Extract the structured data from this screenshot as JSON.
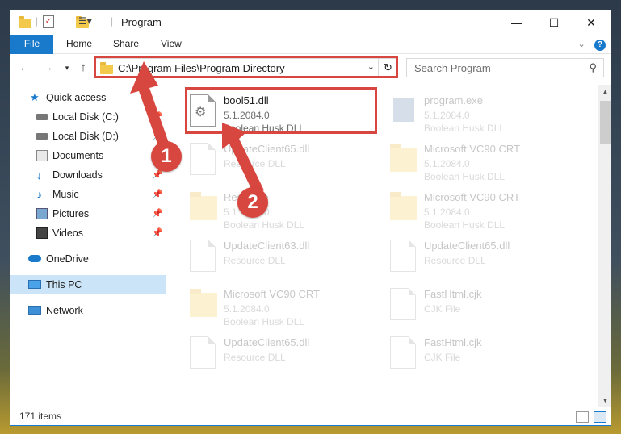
{
  "window": {
    "title": "Program"
  },
  "ribbon": {
    "file": "File",
    "tabs": [
      "Home",
      "Share",
      "View"
    ]
  },
  "address": {
    "path": "C:\\Program Files\\Program Directory"
  },
  "search": {
    "placeholder": "Search Program"
  },
  "sidebar": {
    "items": [
      {
        "label": "Quick access",
        "icon": "star-icon",
        "pinned": false
      },
      {
        "label": "Local Disk (C:)",
        "icon": "drive-icon",
        "pinned": true
      },
      {
        "label": "Local Disk (D:)",
        "icon": "drive-icon",
        "pinned": true
      },
      {
        "label": "Documents",
        "icon": "documents-icon",
        "pinned": true
      },
      {
        "label": "Downloads",
        "icon": "download-icon",
        "pinned": true
      },
      {
        "label": "Music",
        "icon": "music-icon",
        "pinned": true
      },
      {
        "label": "Pictures",
        "icon": "pictures-icon",
        "pinned": true
      },
      {
        "label": "Videos",
        "icon": "videos-icon",
        "pinned": true
      },
      {
        "label": "OneDrive",
        "icon": "cloud-icon",
        "pinned": false
      },
      {
        "label": "This PC",
        "icon": "computer-icon",
        "pinned": false,
        "selected": true
      },
      {
        "label": "Network",
        "icon": "network-icon",
        "pinned": false
      }
    ]
  },
  "files": [
    {
      "name": "bool51.dll",
      "line2": "5.1.2084.0",
      "line3": "Boolean Husk DLL",
      "kind": "dll",
      "faded": false
    },
    {
      "name": "program.exe",
      "line2": "5.1.2084.0",
      "line3": "Boolean Husk DLL",
      "kind": "exe",
      "faded": true
    },
    {
      "name": "UpdateClient65.dll",
      "line2": "Resource DLL",
      "line3": "",
      "kind": "dll",
      "faded": true
    },
    {
      "name": "Microsoft VC90 CRT",
      "line2": "5.1.2084.0",
      "line3": "Boolean Husk DLL",
      "kind": "folder",
      "faded": true
    },
    {
      "name": "Resource",
      "line2": "5.1.2084.0",
      "line3": "Boolean Husk DLL",
      "kind": "folder",
      "faded": true
    },
    {
      "name": "Microsoft VC90 CRT",
      "line2": "5.1.2084.0",
      "line3": "Boolean Husk DLL",
      "kind": "folder",
      "faded": true
    },
    {
      "name": "UpdateClient63.dll",
      "line2": "Resource DLL",
      "line3": "",
      "kind": "dll",
      "faded": true
    },
    {
      "name": "UpdateClient65.dll",
      "line2": "Resource DLL",
      "line3": "",
      "kind": "dll",
      "faded": true
    },
    {
      "name": "Microsoft VC90 CRT",
      "line2": "5.1.2084.0",
      "line3": "Boolean Husk DLL",
      "kind": "folder",
      "faded": true
    },
    {
      "name": "FastHtml.cjk",
      "line2": "CJK File",
      "line3": "",
      "kind": "doc",
      "faded": true
    },
    {
      "name": "UpdateClient65.dll",
      "line2": "Resource DLL",
      "line3": "",
      "kind": "dll",
      "faded": true
    },
    {
      "name": "FastHtml.cjk",
      "line2": "CJK File",
      "line3": "",
      "kind": "doc",
      "faded": true
    }
  ],
  "status": {
    "items": "171 items"
  },
  "annotations": {
    "marker1": "1",
    "marker2": "2"
  },
  "colors": {
    "accent": "#1979ca",
    "annotation": "#d8473f",
    "selection": "#cce4f7"
  }
}
